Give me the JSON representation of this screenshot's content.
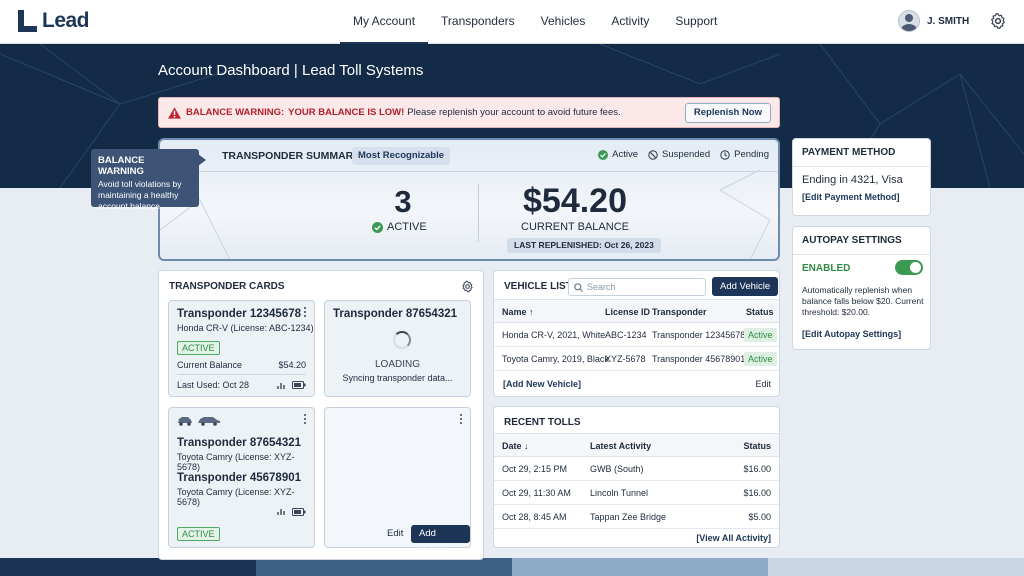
{
  "app": {
    "logo_text": "Lead"
  },
  "nav": {
    "items": [
      {
        "label": "My Account",
        "active": true
      },
      {
        "label": "Transponders"
      },
      {
        "label": "Vehicles"
      },
      {
        "label": "Activity"
      },
      {
        "label": "Support"
      }
    ],
    "user_name": "J. SMITH"
  },
  "page": {
    "title": "Account Dashboard | Lead Toll Systems"
  },
  "warning": {
    "label": "BALANCE WARNING:",
    "strong": "YOUR BALANCE IS LOW!",
    "text": "Please replenish your account to avoid future fees.",
    "button": "Replenish Now"
  },
  "tooltip": {
    "title": "BALANCE WARNING",
    "body": "Avoid toll violations by maintaining a healthy account balance."
  },
  "summary": {
    "title": "TRANSPONDER SUMMARY",
    "chip": "Most Recognizable",
    "legend": {
      "active": "Active",
      "suspended": "Suspended",
      "pending": "Pending"
    },
    "active_count": "3",
    "active_label": "ACTIVE",
    "balance": "$54.20",
    "balance_label": "CURRENT BALANCE",
    "last_replenished": "LAST REPLENISHED: Oct 26, 2023"
  },
  "payment": {
    "title": "PAYMENT METHOD",
    "value": "Ending in 4321, Visa",
    "edit_link": "[Edit Payment Method]"
  },
  "autopay": {
    "title": "AUTOPAY SETTINGS",
    "status": "ENABLED",
    "enabled": true,
    "description": "Automatically replenish when balance falls below $20. Current threshold: $20.00.",
    "edit_link": "[Edit Autopay Settings]"
  },
  "transponder_cards": {
    "title": "TRANSPONDER CARDS",
    "card1": {
      "name": "Transponder 12345678",
      "vehicle": "Honda CR-V (License: ABC-1234)",
      "status": "ACTIVE",
      "balance_label": "Current Balance",
      "balance": "$54.20",
      "last_used": "Last Used: Oct 28"
    },
    "card2": {
      "name": "Transponder 87654321",
      "loading": "LOADING",
      "syncing": "Syncing transponder data..."
    },
    "card3": {
      "name_a": "Transponder 87654321",
      "vehicle_a": "Toyota Camry (License: XYZ-5678)",
      "name_b": "Transponder 45678901",
      "vehicle_b": "Toyota Camry (License: XYZ-5678)",
      "status": "ACTIVE"
    },
    "card4": {
      "edit": "Edit",
      "add_vehicle": "Add Vehicle"
    }
  },
  "vehicle_list": {
    "title": "VEHICLE LIST",
    "search_placeholder": "Search",
    "add_button": "Add Vehicle",
    "columns": {
      "name": "Name",
      "license": "License ID",
      "transponder": "Transponder",
      "status": "Status"
    },
    "rows": [
      {
        "name": "Honda CR-V, 2021, White",
        "license": "ABC-1234",
        "transponder": "Transponder 12345678",
        "status": "Active"
      },
      {
        "name": "Toyota Camry, 2019, Black",
        "license": "XYZ-5678",
        "transponder": "Transponder 45678901",
        "status": "Active"
      }
    ],
    "add_link": "[Add New Vehicle]",
    "edit": "Edit"
  },
  "recent_tolls": {
    "title": "RECENT TOLLS",
    "columns": {
      "date": "Date",
      "activity": "Latest Activity",
      "status": "Status"
    },
    "rows": [
      {
        "date": "Oct 29, 2:15 PM",
        "activity": "GWB (South)",
        "amount": "$16.00"
      },
      {
        "date": "Oct 29, 11:30 AM",
        "activity": "Lincoln Tunnel",
        "amount": "$16.00"
      },
      {
        "date": "Oct 28, 8:45 AM",
        "activity": "Tappan Zee Bridge",
        "amount": "$5.00"
      }
    ],
    "view_all": "[View All Activity]"
  },
  "colors": {
    "navy": "#1d3657",
    "hero": "#142b48",
    "success": "#2e8b45",
    "danger": "#b1202b"
  }
}
